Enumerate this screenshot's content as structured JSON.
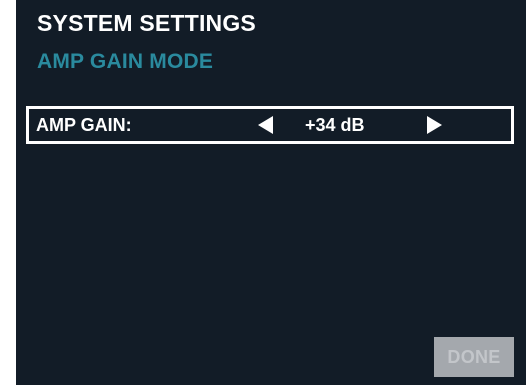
{
  "header": {
    "title": "SYSTEM SETTINGS",
    "subtitle": "AMP GAIN MODE"
  },
  "amp_gain": {
    "label": "AMP GAIN:",
    "value": "+34 dB",
    "decrease_icon": "left-triangle-arrow",
    "increase_icon": "right-triangle-arrow"
  },
  "footer": {
    "done_label": "DONE"
  },
  "colors": {
    "background": "#121c27",
    "title": "#ffffff",
    "subtitle": "#2a8a9e",
    "done_button_bg": "#a4a8ad",
    "done_button_text": "#c3c6ca"
  }
}
